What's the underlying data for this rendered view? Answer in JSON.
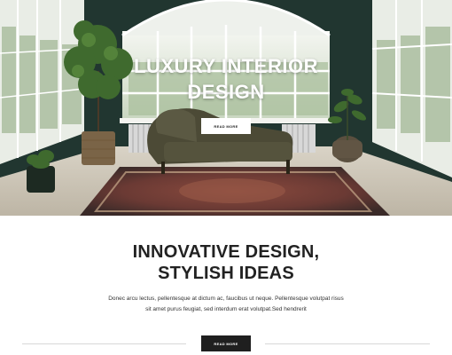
{
  "hero": {
    "title_line1": "LUXURY INTERIOR",
    "title_line2": "DESIGN",
    "button_label": "READ MORE"
  },
  "section": {
    "title_line1": "INNOVATIVE DESIGN,",
    "title_line2": "STYLISH IDEAS",
    "text_line1": "Donec arcu lectus, pellentesque at dictum ac, faucibus ut neque. Pellentesque volutpat risus",
    "text_line2": "sit amet purus feugiat, sed interdum erat volutpat.Sed hendrerit",
    "button_label": "READ MORE"
  },
  "colors": {
    "wall": "#243a33",
    "button_dark": "#1f1f1f",
    "heading": "#222222"
  }
}
